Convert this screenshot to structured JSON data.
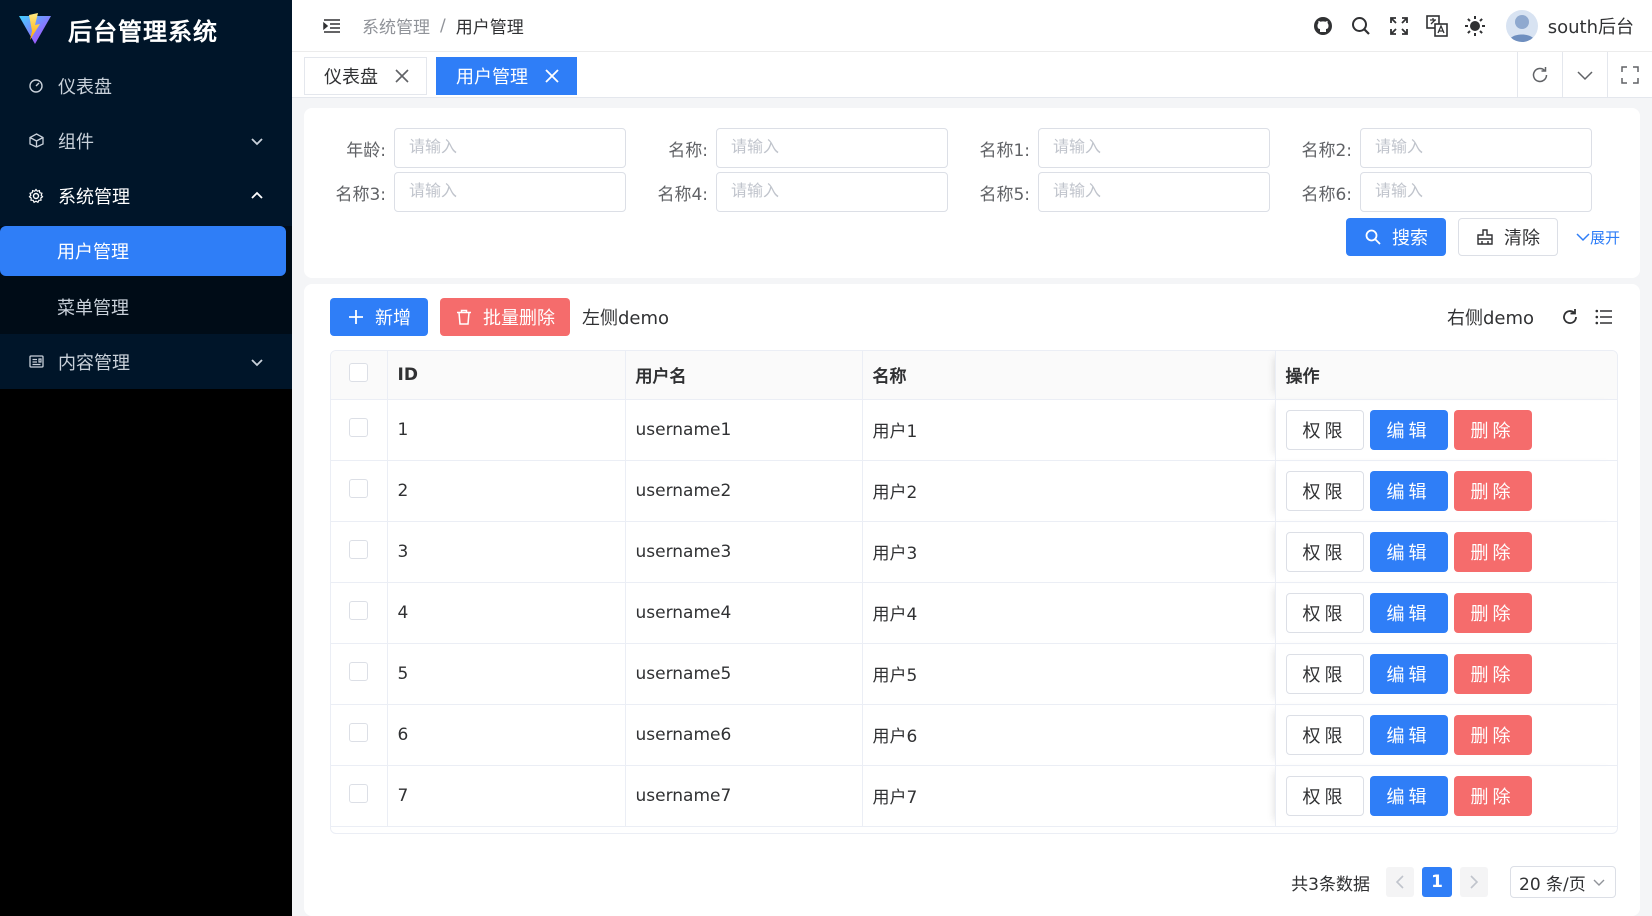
{
  "app": {
    "title": "后台管理系统",
    "brand_color": "#2f7ef7"
  },
  "sidebar": {
    "items": [
      {
        "label": "仪表盘",
        "icon": "dashboard-icon"
      },
      {
        "label": "组件",
        "icon": "cube-icon"
      },
      {
        "label": "系统管理",
        "icon": "gear-icon",
        "open": true,
        "children": [
          {
            "label": "用户管理",
            "active": true
          },
          {
            "label": "菜单管理"
          }
        ]
      },
      {
        "label": "内容管理",
        "icon": "content-icon"
      }
    ]
  },
  "header": {
    "breadcrumb": [
      "系统管理",
      "用户管理"
    ],
    "icons": [
      "github-icon",
      "search-icon",
      "fullscreen-icon",
      "translate-icon",
      "sun-icon"
    ],
    "user": "south后台"
  },
  "tabs": [
    {
      "label": "仪表盘"
    },
    {
      "label": "用户管理",
      "active": true
    }
  ],
  "search": {
    "fields": [
      {
        "label": "年龄:",
        "placeholder": "请输入",
        "value": ""
      },
      {
        "label": "名称:",
        "placeholder": "请输入",
        "value": ""
      },
      {
        "label": "名称1:",
        "placeholder": "请输入",
        "value": ""
      },
      {
        "label": "名称2:",
        "placeholder": "请输入",
        "value": ""
      },
      {
        "label": "名称3:",
        "placeholder": "请输入",
        "value": ""
      },
      {
        "label": "名称4:",
        "placeholder": "请输入",
        "value": ""
      },
      {
        "label": "名称5:",
        "placeholder": "请输入",
        "value": ""
      },
      {
        "label": "名称6:",
        "placeholder": "请输入",
        "value": ""
      }
    ],
    "search_label": "搜索",
    "clear_label": "清除",
    "expand_label": "展开"
  },
  "toolbar": {
    "add_label": "新增",
    "batch_delete_label": "批量删除",
    "left_text": "左侧demo",
    "right_text": "右侧demo"
  },
  "table": {
    "columns": [
      "ID",
      "用户名",
      "名称",
      "操作"
    ],
    "rows": [
      {
        "id": "1",
        "username": "username1",
        "name": "用户1"
      },
      {
        "id": "2",
        "username": "username2",
        "name": "用户2"
      },
      {
        "id": "3",
        "username": "username3",
        "name": "用户3"
      },
      {
        "id": "4",
        "username": "username4",
        "name": "用户4"
      },
      {
        "id": "5",
        "username": "username5",
        "name": "用户5"
      },
      {
        "id": "6",
        "username": "username6",
        "name": "用户6"
      },
      {
        "id": "7",
        "username": "username7",
        "name": "用户7"
      }
    ],
    "row_actions": {
      "perm": "权限",
      "edit": "编辑",
      "delete": "删除"
    }
  },
  "pagination": {
    "total_text": "共3条数据",
    "current_page": "1",
    "page_size": "20 条/页"
  }
}
